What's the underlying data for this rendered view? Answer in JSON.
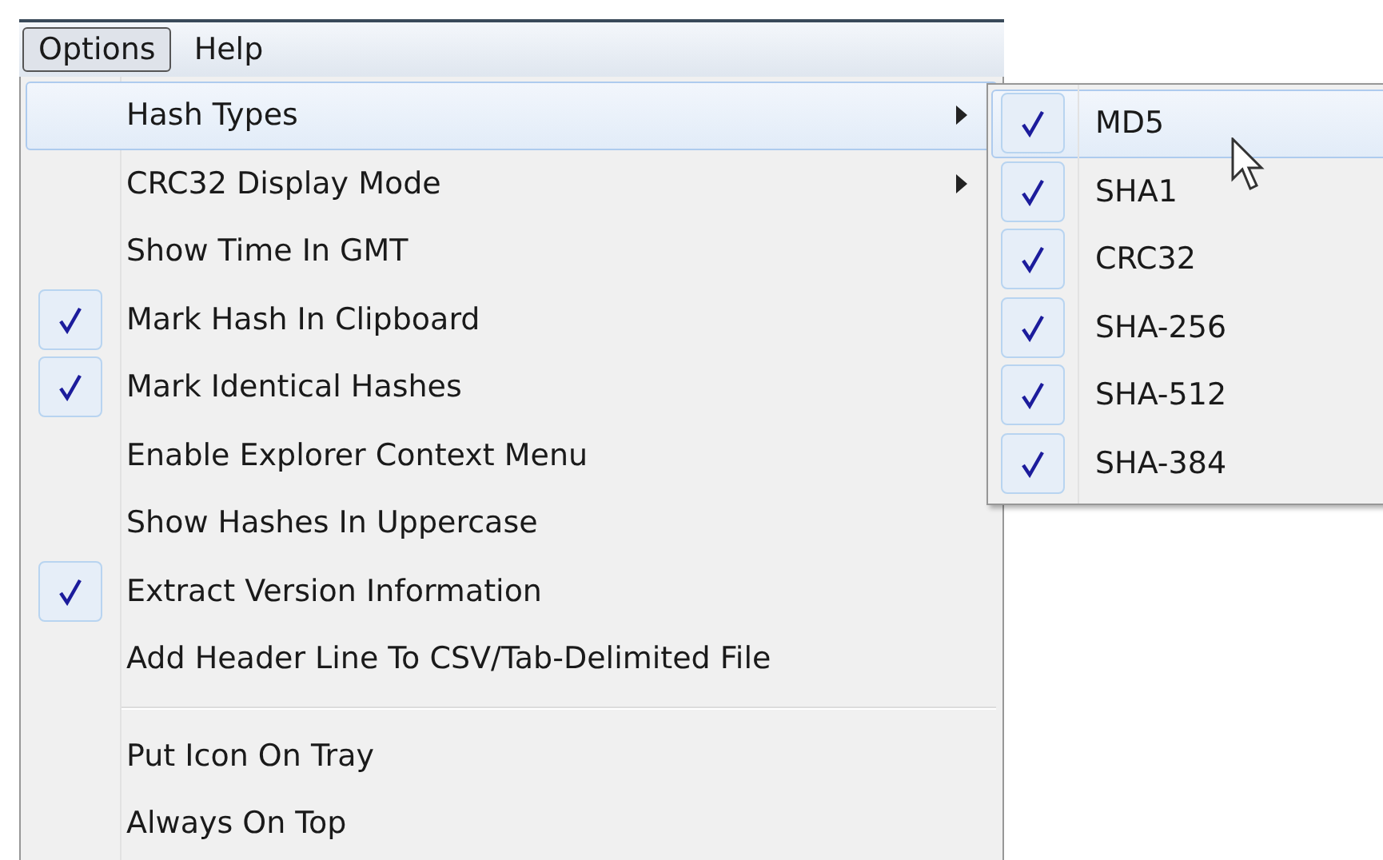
{
  "menu_bar": [
    {
      "label": "Options",
      "selected": true
    },
    {
      "label": "Help",
      "selected": false
    }
  ],
  "menu": [
    {
      "kind": "item",
      "label": "Hash Types",
      "checked": false,
      "highlighted": true,
      "submenu": true
    },
    {
      "kind": "item",
      "label": "CRC32 Display Mode",
      "checked": false,
      "highlighted": false,
      "submenu": true
    },
    {
      "kind": "item",
      "label": "Show Time In GMT",
      "checked": false,
      "highlighted": false,
      "submenu": false
    },
    {
      "kind": "item",
      "label": "Mark Hash In Clipboard",
      "checked": true,
      "highlighted": false,
      "submenu": false
    },
    {
      "kind": "item",
      "label": "Mark Identical Hashes",
      "checked": true,
      "highlighted": false,
      "submenu": false
    },
    {
      "kind": "item",
      "label": "Enable Explorer Context Menu",
      "checked": false,
      "highlighted": false,
      "submenu": false
    },
    {
      "kind": "item",
      "label": "Show Hashes In Uppercase",
      "checked": false,
      "highlighted": false,
      "submenu": false
    },
    {
      "kind": "item",
      "label": "Extract Version Information",
      "checked": true,
      "highlighted": false,
      "submenu": false
    },
    {
      "kind": "item",
      "label": "Add Header Line To CSV/Tab-Delimited File",
      "checked": false,
      "highlighted": false,
      "submenu": false
    },
    {
      "kind": "separator"
    },
    {
      "kind": "item",
      "label": "Put Icon On Tray",
      "checked": false,
      "highlighted": false,
      "submenu": false
    },
    {
      "kind": "item",
      "label": "Always On Top",
      "checked": false,
      "highlighted": false,
      "submenu": false
    }
  ],
  "submenu": [
    {
      "label": "MD5",
      "checked": true,
      "highlighted": true
    },
    {
      "label": "SHA1",
      "checked": true,
      "highlighted": false
    },
    {
      "label": "CRC32",
      "checked": true,
      "highlighted": false
    },
    {
      "label": "SHA-256",
      "checked": true,
      "highlighted": false
    },
    {
      "label": "SHA-512",
      "checked": true,
      "highlighted": false
    },
    {
      "label": "SHA-384",
      "checked": true,
      "highlighted": false
    }
  ]
}
